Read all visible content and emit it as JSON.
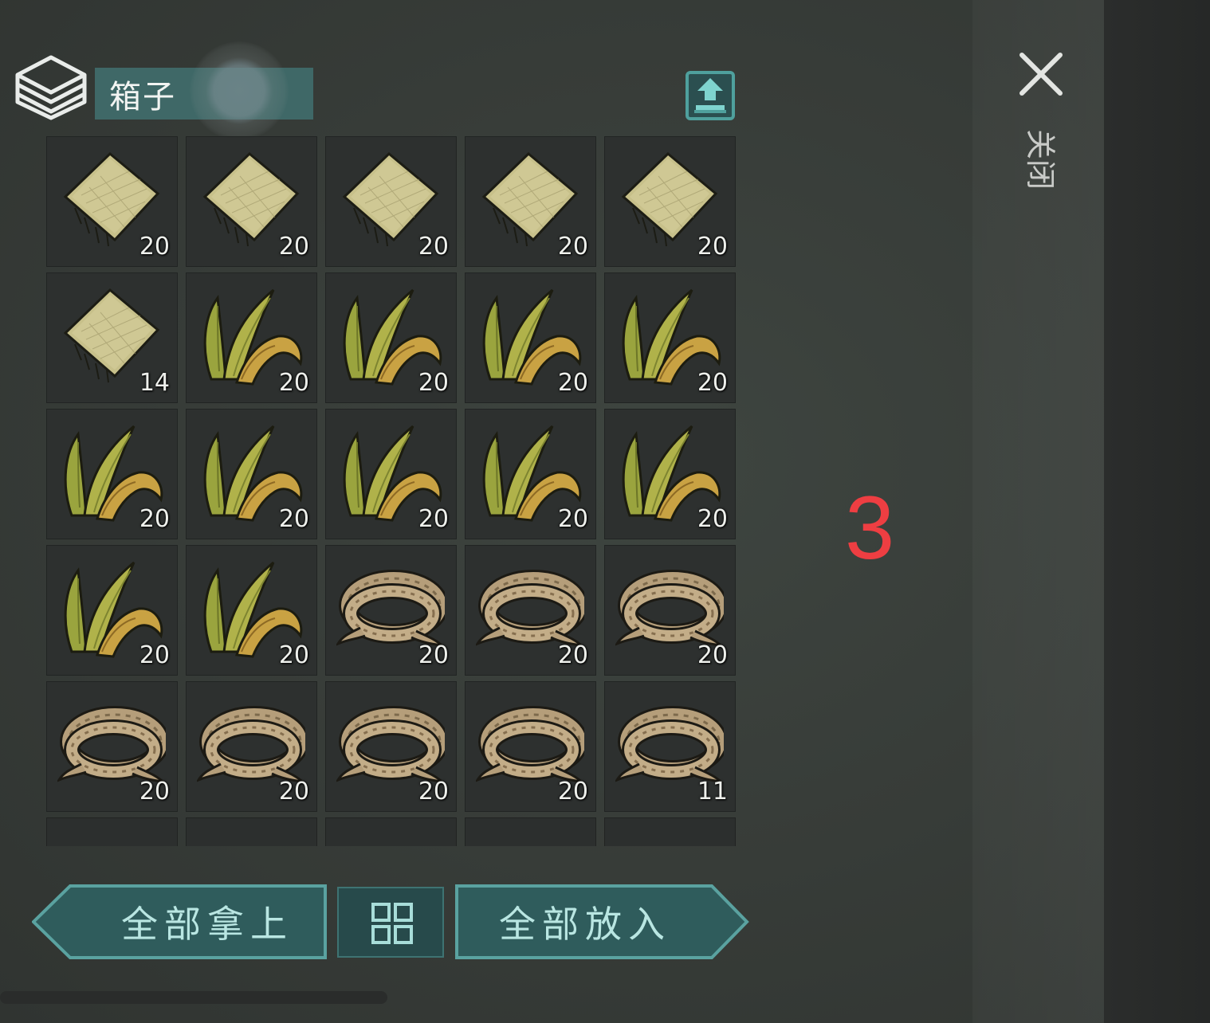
{
  "header": {
    "title": "箱子",
    "container_icon": "stacked-box-icon",
    "transfer_icon": "upload-tray-icon"
  },
  "close": {
    "icon": "close-x-icon",
    "label": "关闭"
  },
  "annotation": {
    "step": "3"
  },
  "inventory": {
    "slots": [
      {
        "item": "fiber-cloth",
        "count": "20"
      },
      {
        "item": "fiber-cloth",
        "count": "20"
      },
      {
        "item": "fiber-cloth",
        "count": "20"
      },
      {
        "item": "fiber-cloth",
        "count": "20"
      },
      {
        "item": "fiber-cloth",
        "count": "20"
      },
      {
        "item": "fiber-cloth",
        "count": "14"
      },
      {
        "item": "plant-leaves",
        "count": "20"
      },
      {
        "item": "plant-leaves",
        "count": "20"
      },
      {
        "item": "plant-leaves",
        "count": "20"
      },
      {
        "item": "plant-leaves",
        "count": "20"
      },
      {
        "item": "plant-leaves",
        "count": "20"
      },
      {
        "item": "plant-leaves",
        "count": "20"
      },
      {
        "item": "plant-leaves",
        "count": "20"
      },
      {
        "item": "plant-leaves",
        "count": "20"
      },
      {
        "item": "plant-leaves",
        "count": "20"
      },
      {
        "item": "plant-leaves",
        "count": "20"
      },
      {
        "item": "plant-leaves",
        "count": "20"
      },
      {
        "item": "rope",
        "count": "20"
      },
      {
        "item": "rope",
        "count": "20"
      },
      {
        "item": "rope",
        "count": "20"
      },
      {
        "item": "rope",
        "count": "20"
      },
      {
        "item": "rope",
        "count": "20"
      },
      {
        "item": "rope",
        "count": "20"
      },
      {
        "item": "rope",
        "count": "20"
      },
      {
        "item": "rope",
        "count": "11"
      },
      {
        "item": "",
        "count": ""
      },
      {
        "item": "",
        "count": ""
      },
      {
        "item": "",
        "count": ""
      },
      {
        "item": "",
        "count": ""
      },
      {
        "item": "",
        "count": ""
      }
    ]
  },
  "actions": {
    "take_all": "全部拿上",
    "put_all": "全部放入",
    "sort_icon": "grid-sort-icon"
  },
  "colors": {
    "accent": "#3f6867",
    "button_fill": "#2f5c5c",
    "button_border": "#5aa2a0",
    "button_text": "#b9e6e2",
    "annotation": "#ee3e42"
  }
}
